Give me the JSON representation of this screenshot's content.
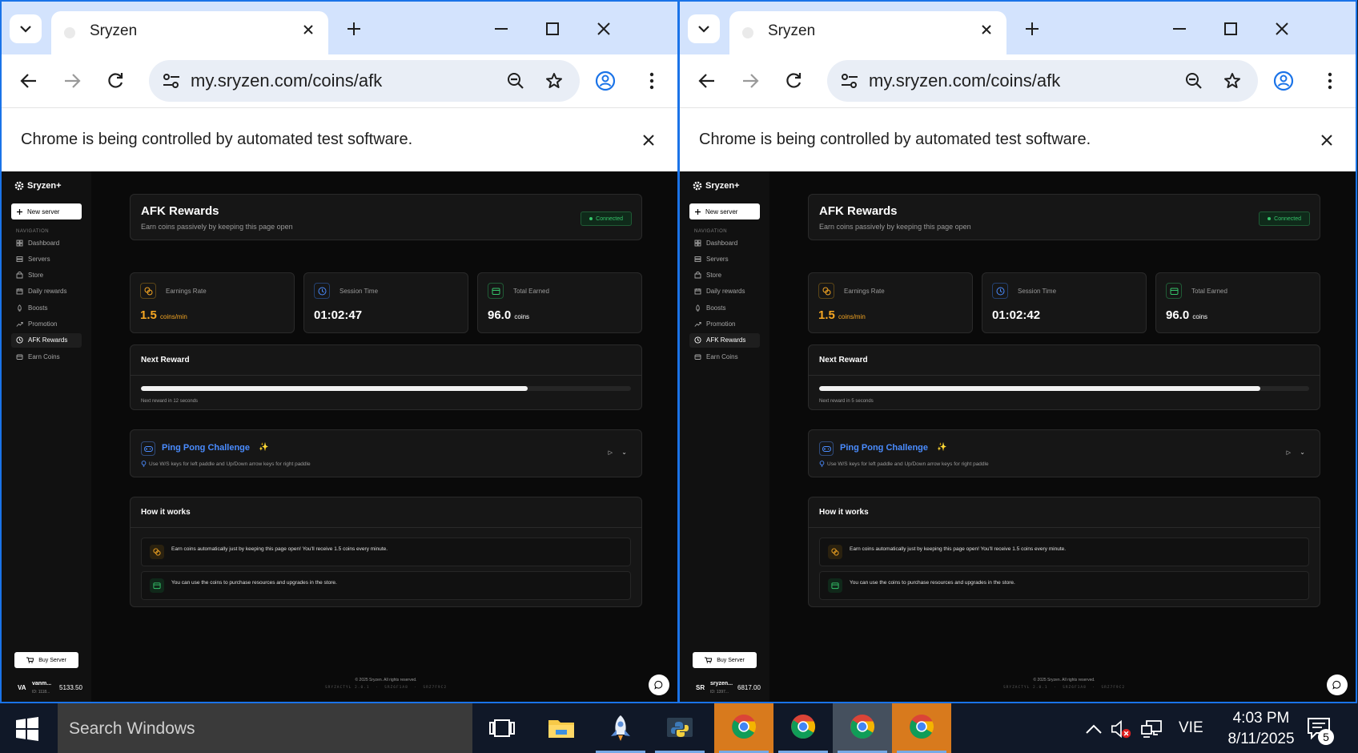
{
  "windows": [
    {
      "tab_title": "Sryzen",
      "url": "my.sryzen.com/coins/afk",
      "infobar_text": "Chrome is being controlled by automated test software.",
      "brand": "Sryzen+",
      "new_server": "New server",
      "nav_heading": "NAVIGATION",
      "nav": [
        {
          "label": "Dashboard",
          "icon": "dashboard-icon"
        },
        {
          "label": "Servers",
          "icon": "servers-icon"
        },
        {
          "label": "Store",
          "icon": "store-icon"
        },
        {
          "label": "Daily rewards",
          "icon": "calendar-icon"
        },
        {
          "label": "Boosts",
          "icon": "rocket-icon"
        },
        {
          "label": "Promotion",
          "icon": "trend-icon"
        },
        {
          "label": "AFK Rewards",
          "icon": "clock-icon",
          "active": true
        },
        {
          "label": "Earn Coins",
          "icon": "wallet-icon"
        }
      ],
      "buy_server": "Buy Server",
      "user": {
        "initials": "VA",
        "name": "vanm...",
        "id": "ID: 1118...",
        "coins": "5133.50"
      },
      "header": {
        "title": "AFK Rewards",
        "subtitle": "Earn coins passively by keeping this page open",
        "status": "Connected"
      },
      "stats": [
        {
          "label": "Earnings Rate",
          "value": "1.5",
          "unit": "coins/min",
          "icon": "coins-icon"
        },
        {
          "label": "Session Time",
          "value": "01:02:47",
          "unit": "",
          "icon": "clock-icon"
        },
        {
          "label": "Total Earned",
          "value": "96.0",
          "unit": "coins",
          "icon": "wallet-icon"
        }
      ],
      "next_reward": {
        "title": "Next Reward",
        "progress": 0.79,
        "note": "Next reward in 12 seconds"
      },
      "game": {
        "title": "Ping Pong Challenge",
        "hint": "Use W/S keys for left paddle and Up/Down arrow keys for right paddle"
      },
      "how": {
        "title": "How it works",
        "items": [
          {
            "text": "Earn coins automatically just by keeping this page open! You'll receive 1.5 coins every minute.",
            "icon": "coins-icon"
          },
          {
            "text": "You can use the coins to purchase resources and upgrades in the store.",
            "icon": "wallet-icon"
          }
        ]
      },
      "footer_copy": "© 2025 Sryzen. All rights reserved.",
      "footer_versions": [
        "SRYZACTYL 2.0.1",
        "SRZ6F1A8",
        "SRZ7F9C2"
      ]
    },
    {
      "tab_title": "Sryzen",
      "url": "my.sryzen.com/coins/afk",
      "infobar_text": "Chrome is being controlled by automated test software.",
      "brand": "Sryzen+",
      "new_server": "New server",
      "nav_heading": "NAVIGATION",
      "nav": [
        {
          "label": "Dashboard",
          "icon": "dashboard-icon"
        },
        {
          "label": "Servers",
          "icon": "servers-icon"
        },
        {
          "label": "Store",
          "icon": "store-icon"
        },
        {
          "label": "Daily rewards",
          "icon": "calendar-icon"
        },
        {
          "label": "Boosts",
          "icon": "rocket-icon"
        },
        {
          "label": "Promotion",
          "icon": "trend-icon"
        },
        {
          "label": "AFK Rewards",
          "icon": "clock-icon",
          "active": true
        },
        {
          "label": "Earn Coins",
          "icon": "wallet-icon"
        }
      ],
      "buy_server": "Buy Server",
      "user": {
        "initials": "SR",
        "name": "sryzen...",
        "id": "ID: 1397...",
        "coins": "6817.00"
      },
      "header": {
        "title": "AFK Rewards",
        "subtitle": "Earn coins passively by keeping this page open",
        "status": "Connected"
      },
      "stats": [
        {
          "label": "Earnings Rate",
          "value": "1.5",
          "unit": "coins/min",
          "icon": "coins-icon"
        },
        {
          "label": "Session Time",
          "value": "01:02:42",
          "unit": "",
          "icon": "clock-icon"
        },
        {
          "label": "Total Earned",
          "value": "96.0",
          "unit": "coins",
          "icon": "wallet-icon"
        }
      ],
      "next_reward": {
        "title": "Next Reward",
        "progress": 0.9,
        "note": "Next reward in 5 seconds"
      },
      "game": {
        "title": "Ping Pong Challenge",
        "hint": "Use W/S keys for left paddle and Up/Down arrow keys for right paddle"
      },
      "how": {
        "title": "How it works",
        "items": [
          {
            "text": "Earn coins automatically just by keeping this page open! You'll receive 1.5 coins every minute.",
            "icon": "coins-icon"
          },
          {
            "text": "You can use the coins to purchase resources and upgrades in the store.",
            "icon": "wallet-icon"
          }
        ]
      },
      "footer_copy": "© 2025 Sryzen. All rights reserved.",
      "footer_versions": [
        "SRYZACTYL 2.0.1",
        "SRZ6F1A8",
        "SRZ7F9C2"
      ]
    }
  ],
  "taskbar": {
    "search_placeholder": "Search Windows",
    "apps": [
      {
        "name": "task-view-icon"
      },
      {
        "name": "file-explorer-icon"
      },
      {
        "name": "rocket-app-icon"
      },
      {
        "name": "python-icon"
      },
      {
        "name": "chrome-icon",
        "state": "highlight"
      },
      {
        "name": "chrome-icon",
        "state": "running"
      },
      {
        "name": "chrome-icon",
        "state": "active"
      },
      {
        "name": "chrome-icon",
        "state": "highlight"
      }
    ],
    "language": "VIE",
    "time": "4:03 PM",
    "date": "8/11/2025",
    "notification_count": "5"
  },
  "colors": {
    "accent": "#1a73e8",
    "gold": "#f5a623",
    "green": "#35c46a",
    "link_blue": "#4a8cff",
    "taskbar_highlight": "#d87a1d"
  }
}
